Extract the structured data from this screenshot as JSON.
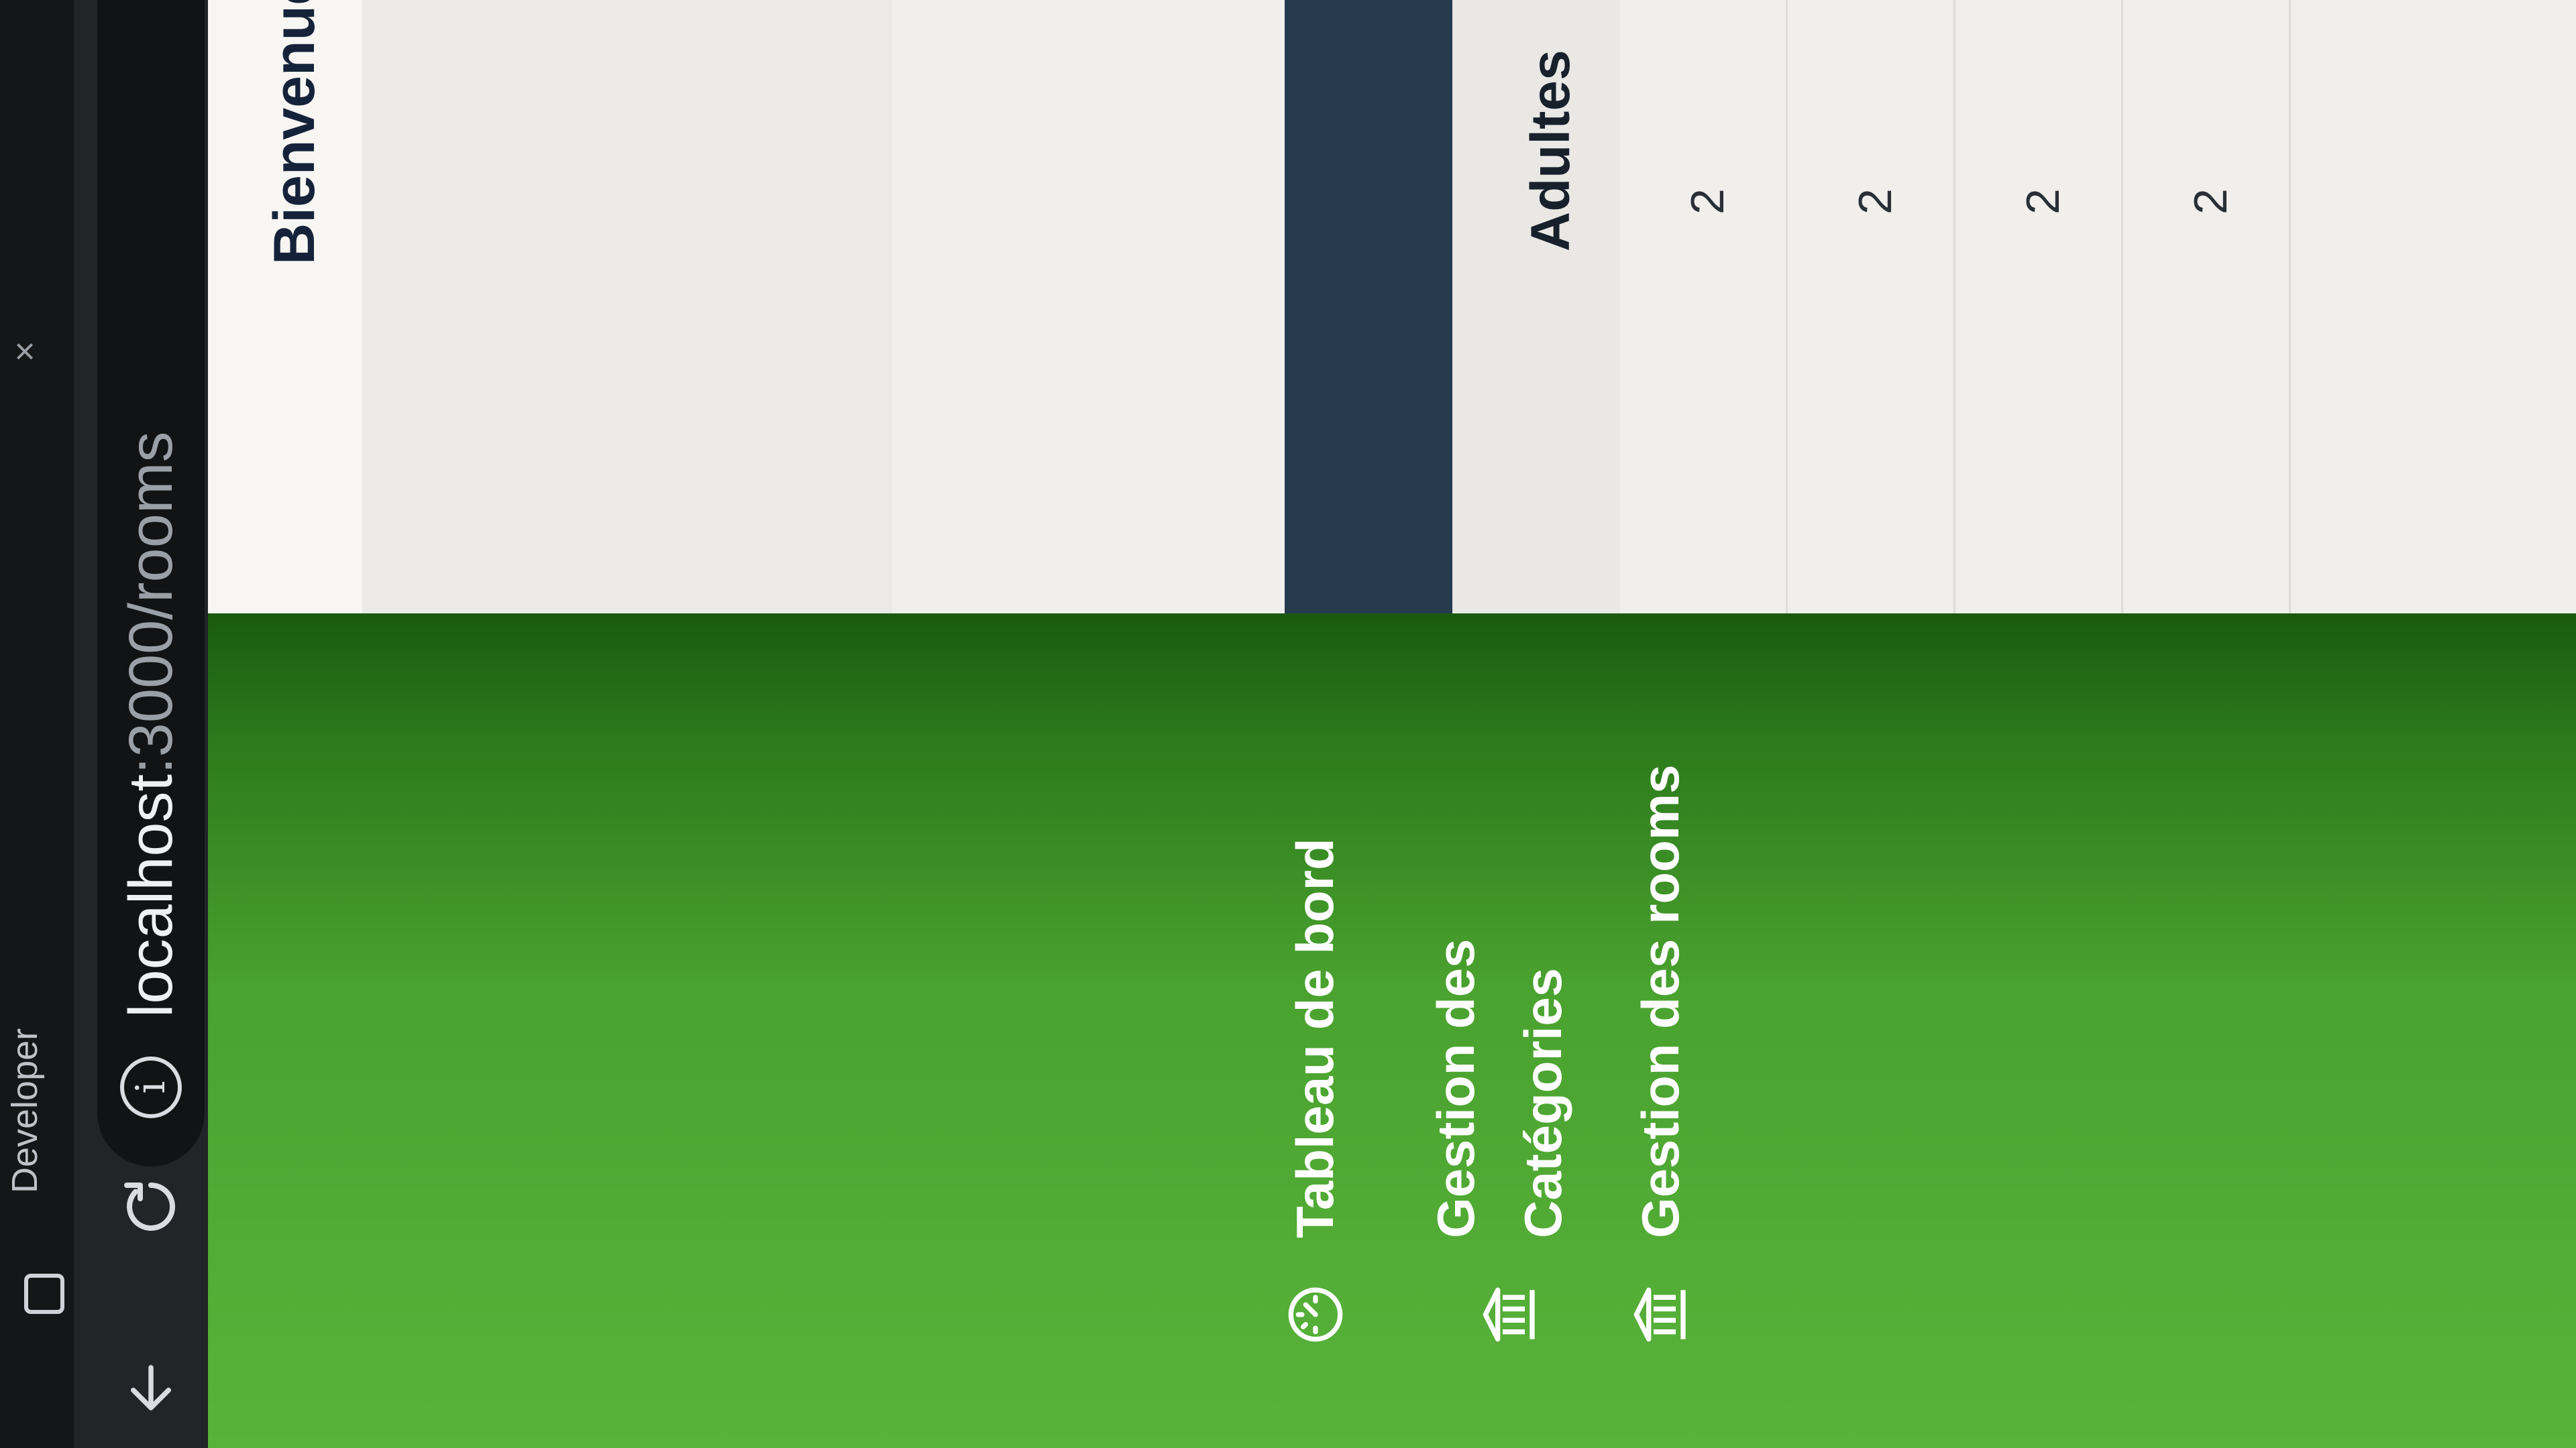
{
  "browser": {
    "tab_title": "Developer",
    "tab_close": "×",
    "url_host": "localhost",
    "url_rest": ":3000/rooms"
  },
  "sidebar": {
    "items": [
      {
        "label": "Tableau de bord",
        "icon": "gauge-icon"
      },
      {
        "label": "Gestion des Catégories",
        "icon": "bank-icon"
      },
      {
        "label": "Gestion des rooms",
        "icon": "bank-icon"
      }
    ]
  },
  "main": {
    "welcome": "Bienvenue",
    "table": {
      "columns": [
        "Adultes"
      ],
      "rows": [
        {
          "adultes": "2"
        },
        {
          "adultes": "2"
        },
        {
          "adultes": "2"
        },
        {
          "adultes": "2"
        }
      ]
    }
  },
  "colors": {
    "sidebar_green": "#4aa22f",
    "dark_bar": "#273b4e",
    "title_text": "#15233a"
  }
}
